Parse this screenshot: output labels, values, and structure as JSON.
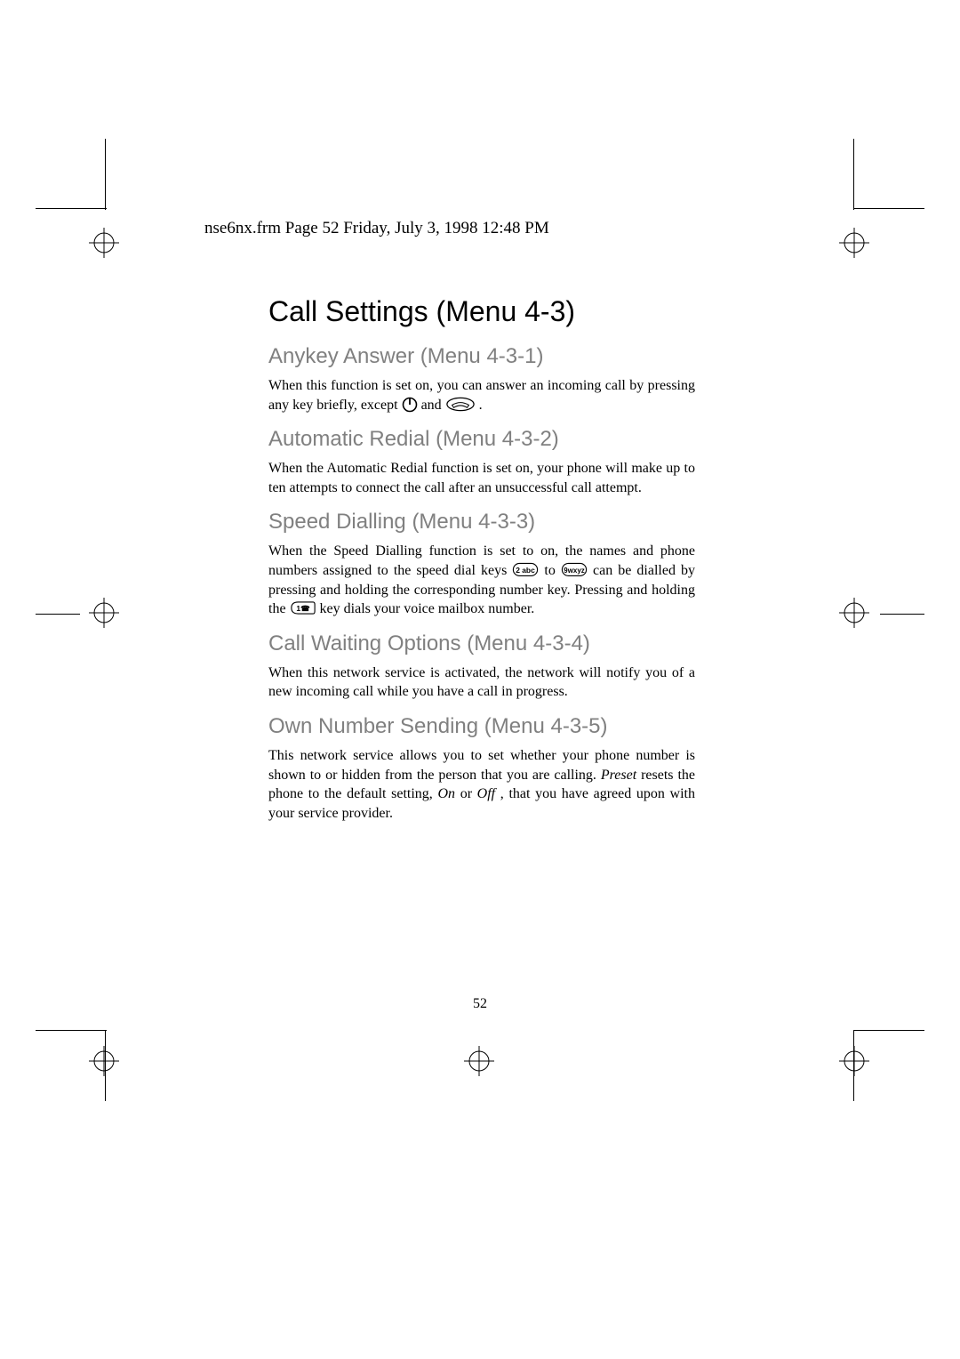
{
  "header": {
    "text": "nse6nx.frm  Page 52  Friday, July 3, 1998  12:48 PM"
  },
  "page_number": "52",
  "title": "Call Settings (Menu 4-3)",
  "sections": [
    {
      "heading": "Anykey Answer (Menu 4-3-1)",
      "body_before": "When this function is set on, you can answer an incoming call by pressing any key briefly, except ",
      "body_middle": " and ",
      "body_after": "."
    },
    {
      "heading": "Automatic Redial (Menu 4-3-2)",
      "body": "When the Automatic Redial function is set on, your phone will make up to ten attempts to connect the call after an unsuccessful call attempt."
    },
    {
      "heading": "Speed Dialling (Menu 4-3-3)",
      "body_before": "When the Speed Dialling function is set to on, the names and phone numbers assigned to the speed dial keys ",
      "body_mid1": " to ",
      "body_mid2": " can be dialled by pressing and holding the corresponding number key. Pressing and holding the ",
      "body_after": " key dials your voice mailbox number."
    },
    {
      "heading": "Call Waiting Options (Menu 4-3-4)",
      "body": "When this network service is activated, the network will notify you of a new incoming call while you have a call in progress."
    },
    {
      "heading": "Own Number Sending (Menu 4-3-5)",
      "body_before": "This network service allows you to set whether your phone number is shown to or hidden from the person that you are calling. ",
      "emph1": "Preset",
      "body_mid1": " resets the phone to the default setting, ",
      "emph2": "On",
      "body_mid2": " or ",
      "emph3": "Off",
      "body_after": " , that you have agreed upon with your service provider."
    }
  ],
  "icons": {
    "power": "power-icon",
    "end": "end-key-icon",
    "key2": "key-2abc-icon",
    "key9": "key-9wxyz-icon",
    "key1": "key-1-icon"
  }
}
